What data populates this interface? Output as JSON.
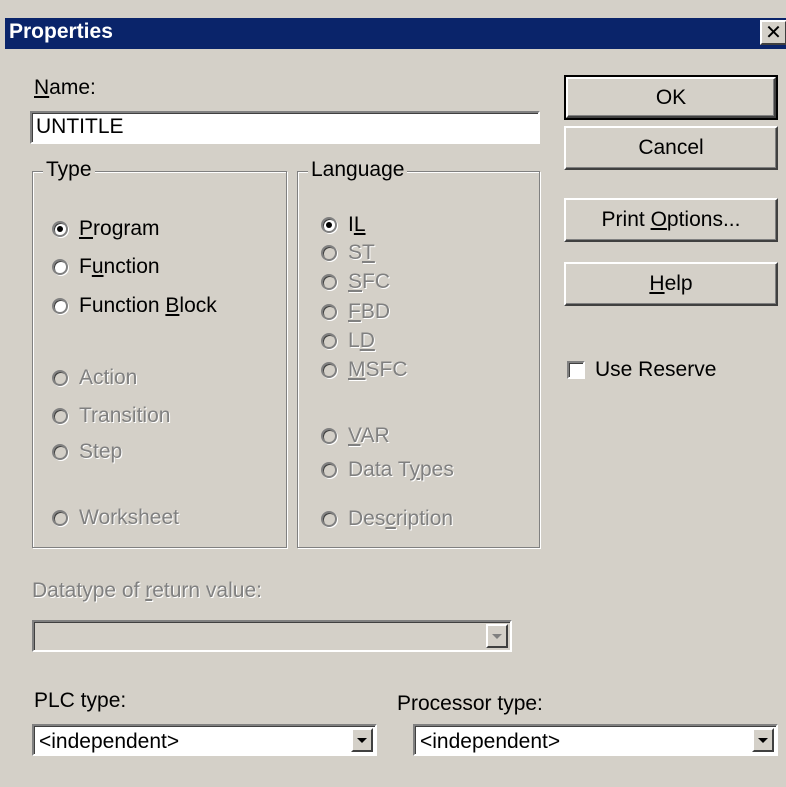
{
  "window": {
    "title": "Properties",
    "close_glyph": "✕"
  },
  "name": {
    "label_u": "N",
    "label_rest": "ame:",
    "value": "UNTITLE"
  },
  "buttons": {
    "ok": "OK",
    "cancel": "Cancel",
    "print_pre": "Print ",
    "print_u": "O",
    "print_post": "ptions...",
    "help_u": "H",
    "help_post": "elp"
  },
  "use_reserve": {
    "label": "Use Reserve",
    "checked": false
  },
  "type_group": {
    "legend": "Type",
    "items": [
      {
        "pre": "",
        "u": "P",
        "post": "rogram",
        "checked": true,
        "enabled": true
      },
      {
        "pre": "F",
        "u": "u",
        "post": "nction",
        "checked": false,
        "enabled": true
      },
      {
        "pre": "Function ",
        "u": "B",
        "post": "lock",
        "checked": false,
        "enabled": true
      },
      {
        "label": "Action",
        "enabled": false
      },
      {
        "label": "Transition",
        "enabled": false
      },
      {
        "label": "Step",
        "enabled": false
      },
      {
        "label": "Worksheet",
        "enabled": false
      }
    ]
  },
  "language_group": {
    "legend": "Language",
    "items": [
      {
        "pre": "I",
        "u": "L",
        "post": "",
        "checked": true,
        "enabled": true
      },
      {
        "pre": "S",
        "u": "T",
        "post": "",
        "enabled": false
      },
      {
        "pre": "",
        "u": "S",
        "post": "FC",
        "enabled": false
      },
      {
        "pre": "",
        "u": "F",
        "post": "BD",
        "enabled": false
      },
      {
        "pre": "L",
        "u": "D",
        "post": "",
        "enabled": false
      },
      {
        "pre": "",
        "u": "M",
        "post": "SFC",
        "enabled": false
      },
      {
        "pre": "",
        "u": "V",
        "post": "AR",
        "enabled": false
      },
      {
        "pre": "Data T",
        "u": "y",
        "post": "pes",
        "enabled": false
      },
      {
        "pre": "Des",
        "u": "c",
        "post": "ription",
        "enabled": false
      }
    ]
  },
  "return_value": {
    "pre": "Datatype of ",
    "u": "r",
    "post": "eturn value:",
    "value": ""
  },
  "plc": {
    "label": "PLC type:",
    "value": "<independent>"
  },
  "processor": {
    "label": "Processor type:",
    "value": "<independent>"
  }
}
